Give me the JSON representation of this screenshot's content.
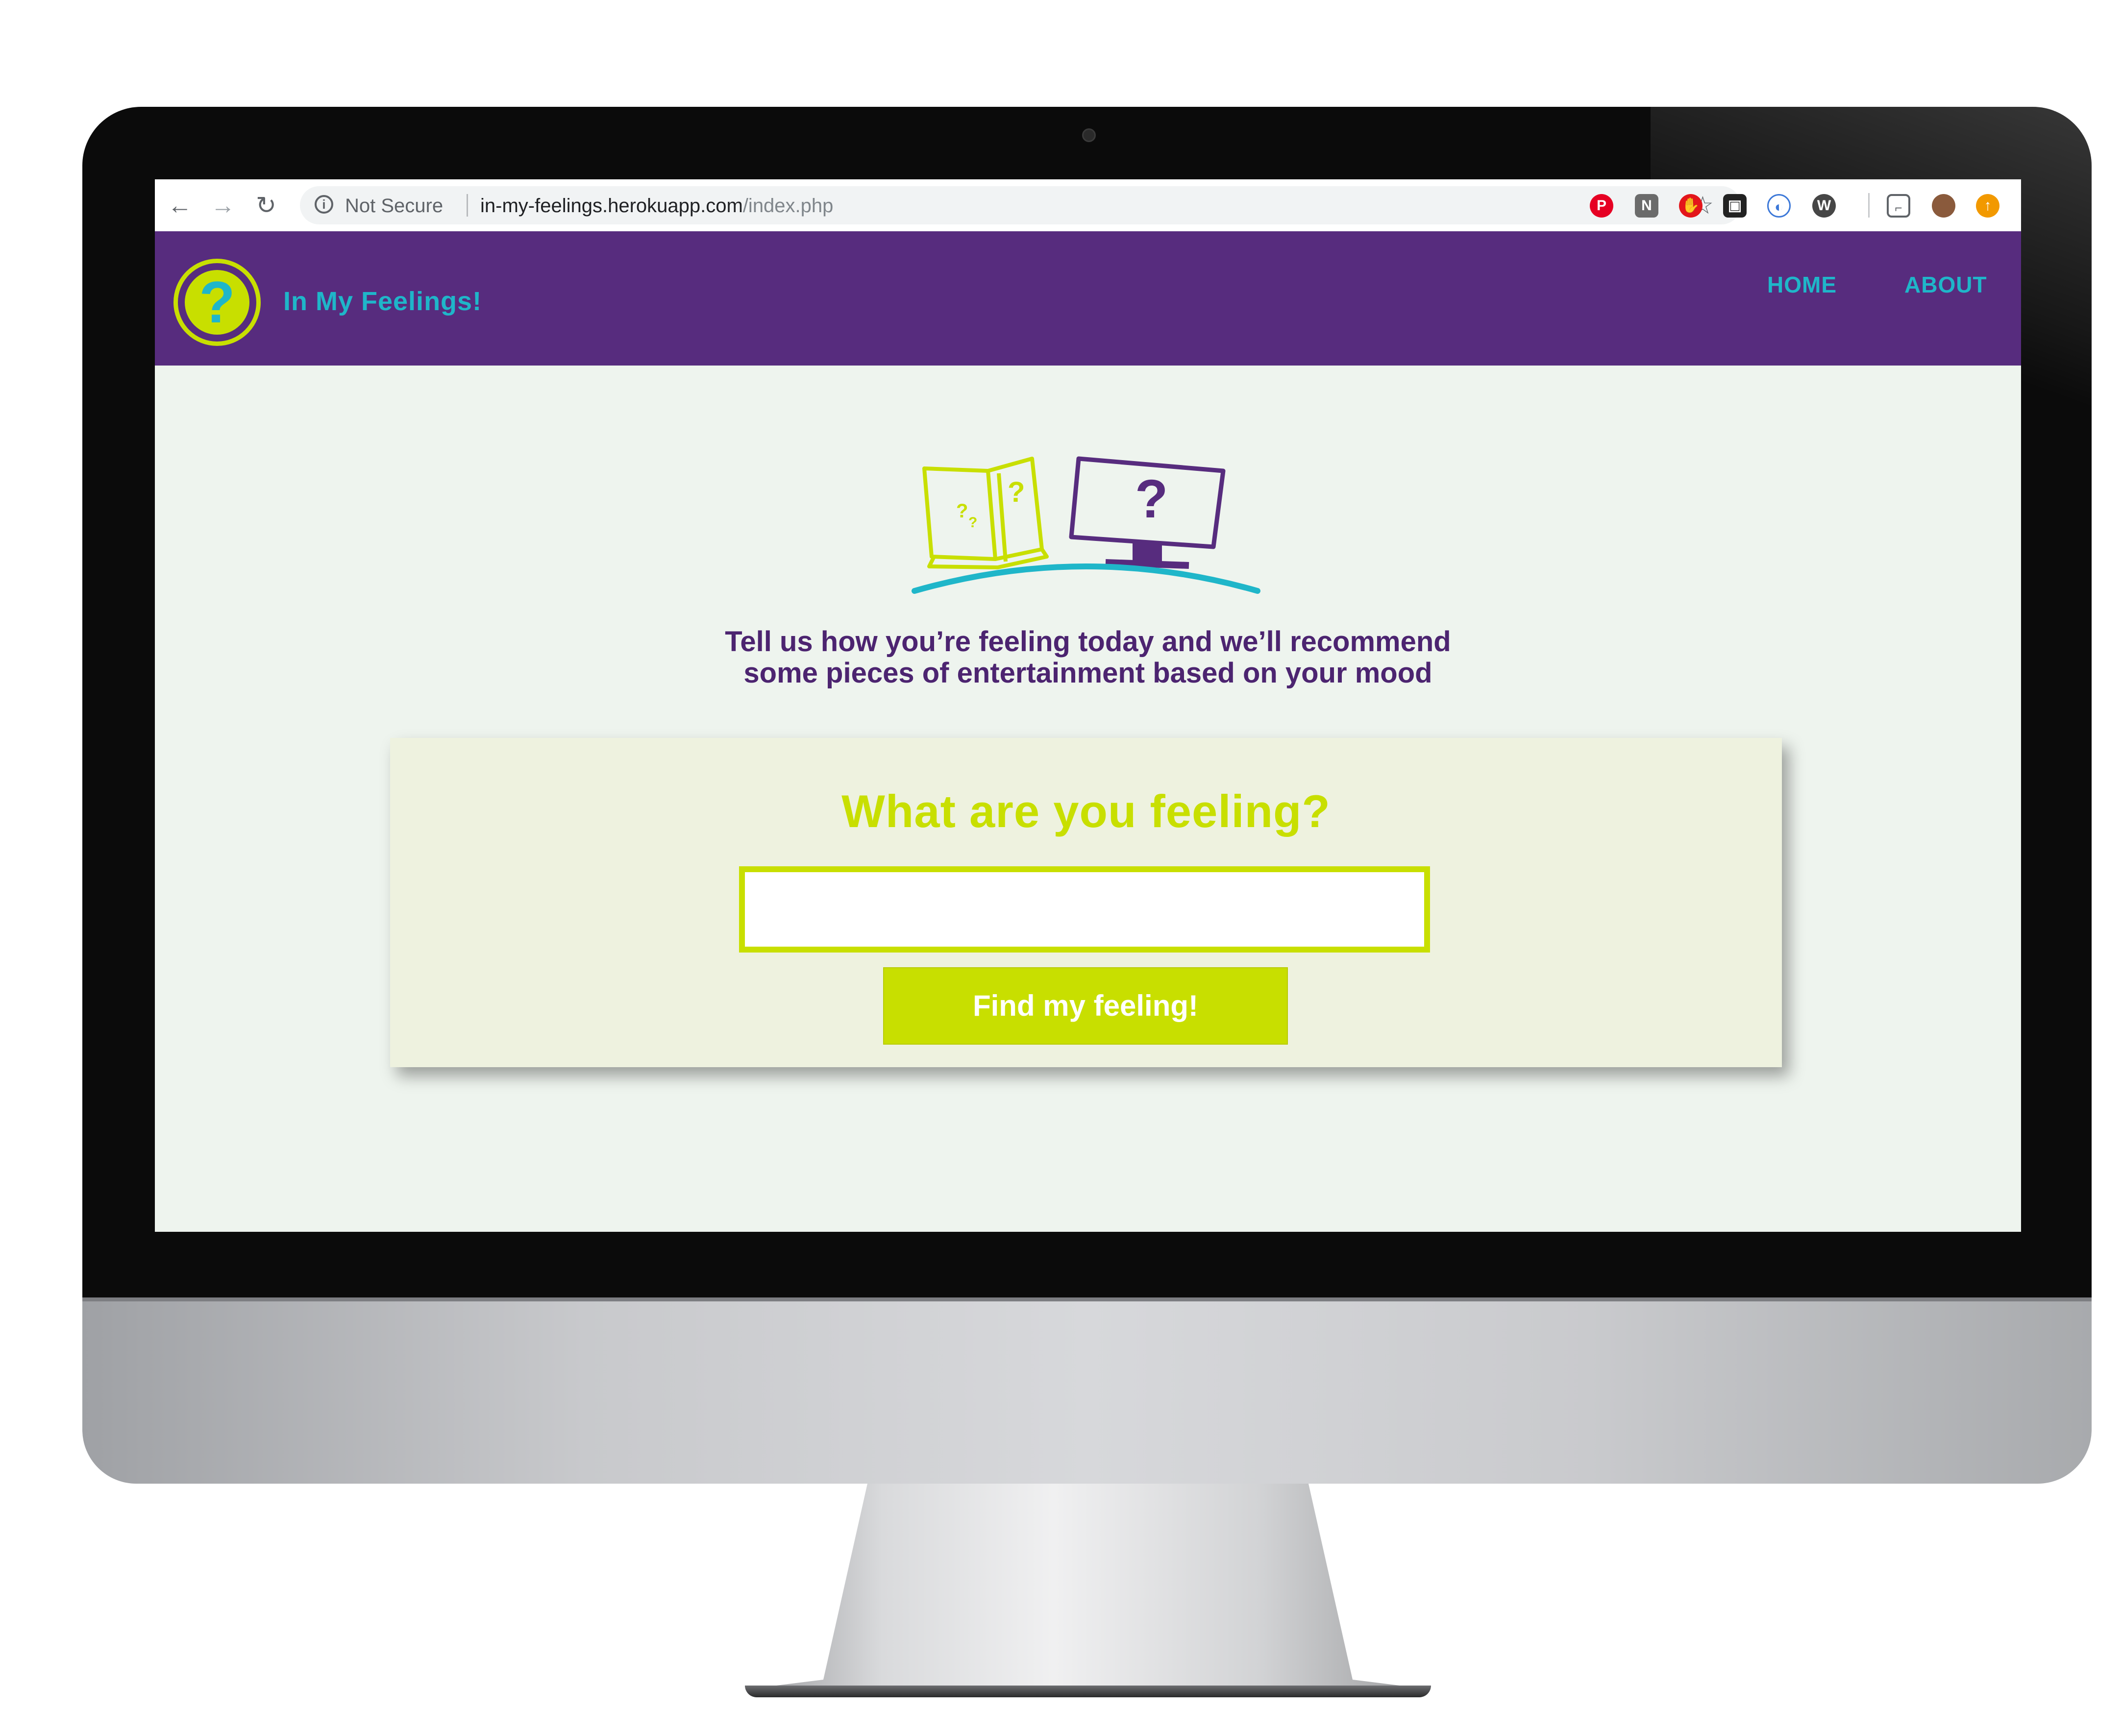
{
  "browser": {
    "security_label": "Not Secure",
    "url_host": "in-my-feelings.herokuapp.com",
    "url_path": "/index.php",
    "back_icon": "arrow-left-icon",
    "forward_icon": "arrow-right-icon",
    "reload_icon": "reload-icon",
    "bookmark_icon": "star-icon",
    "extensions": [
      {
        "name": "pinterest-icon",
        "glyph": "P",
        "color": "#e60023"
      },
      {
        "name": "notion-icon",
        "glyph": "N",
        "color": "#6b6b6b"
      },
      {
        "name": "adblock-icon",
        "glyph": "✋",
        "color": "#e3161b"
      },
      {
        "name": "screenshot-icon",
        "glyph": "▣",
        "color": "#222222"
      },
      {
        "name": "compass-icon",
        "glyph": "◐",
        "color": "#3c78d8"
      },
      {
        "name": "wordpress-icon",
        "glyph": "W",
        "color": "#464646"
      },
      {
        "name": "cast-icon",
        "glyph": "⌐",
        "color": "#5f6368"
      },
      {
        "name": "profile-avatar-icon",
        "glyph": "●",
        "color": "#8a5a3c"
      },
      {
        "name": "update-icon",
        "glyph": "↑",
        "color": "#f29900"
      }
    ]
  },
  "site": {
    "brand": "In My Feelings!",
    "logo_glyph": "?",
    "nav": {
      "home": "HOME",
      "about": "ABOUT"
    },
    "colors": {
      "purple": "#572c7e",
      "lime": "#c8df00",
      "teal": "#1fb6c9"
    }
  },
  "hero": {
    "tagline_line1": "Tell us how you’re feeling today and we’ll recommend",
    "tagline_line2": "some pieces of entertainment based on your mood",
    "book_glyphs": [
      "?",
      "?",
      "?"
    ],
    "monitor_glyph": "?"
  },
  "form": {
    "title": "What are you feeling?",
    "input_value": "",
    "button_label": "Find my feeling!"
  }
}
